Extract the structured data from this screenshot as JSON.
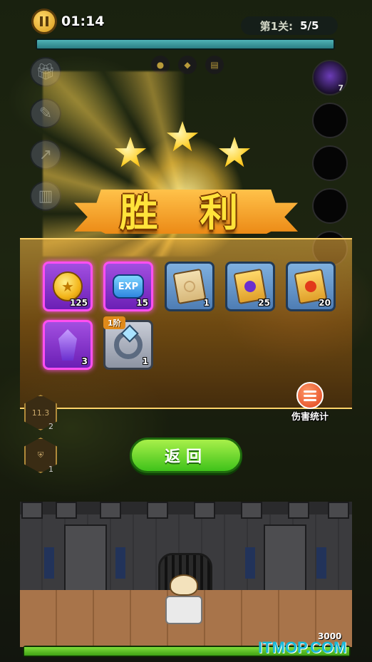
{
  "hud": {
    "timer": "01:14",
    "stage_label": "第1关:",
    "stage_value": "5/5",
    "wave_progress": 1.0,
    "mini_resources": [
      "coin-icon",
      "exp-icon",
      "scroll-icon"
    ]
  },
  "left_menu": [
    "gift-icon",
    "skill-icon",
    "stats-icon",
    "book-icon"
  ],
  "right_slots": [
    {
      "count": "7"
    },
    {
      "count": ""
    },
    {
      "count": ""
    },
    {
      "count": ""
    },
    {
      "count": ""
    }
  ],
  "victory": {
    "stars": 3,
    "title": "胜 利"
  },
  "rewards": [
    {
      "name": "coin",
      "icon": "coin-icon",
      "qty": "125",
      "rarity": "purple"
    },
    {
      "name": "exp",
      "icon": "exp-icon",
      "label": "EXP",
      "qty": "15",
      "rarity": "purple"
    },
    {
      "name": "scroll",
      "icon": "scroll-icon",
      "qty": "1",
      "rarity": "blue"
    },
    {
      "name": "purple-scroll",
      "icon": "purple-scroll-icon",
      "qty": "25",
      "rarity": "blue"
    },
    {
      "name": "red-scroll",
      "icon": "red-scroll-icon",
      "qty": "20",
      "rarity": "blue"
    },
    {
      "name": "crystal",
      "icon": "crystal-icon",
      "qty": "3",
      "rarity": "purple"
    },
    {
      "name": "ring",
      "icon": "ring-icon",
      "qty": "1",
      "tier": "1阶",
      "rarity": "gray"
    }
  ],
  "damage_stats": {
    "label": "伤害统计"
  },
  "return_button": {
    "label": "返回"
  },
  "hex_buffs": [
    {
      "label": "11.3",
      "count": "2"
    },
    {
      "label": "",
      "count": "1"
    }
  ],
  "castle_hp": {
    "value": "3000",
    "fraction": 1.0
  },
  "watermark": "ITMOP.COM"
}
